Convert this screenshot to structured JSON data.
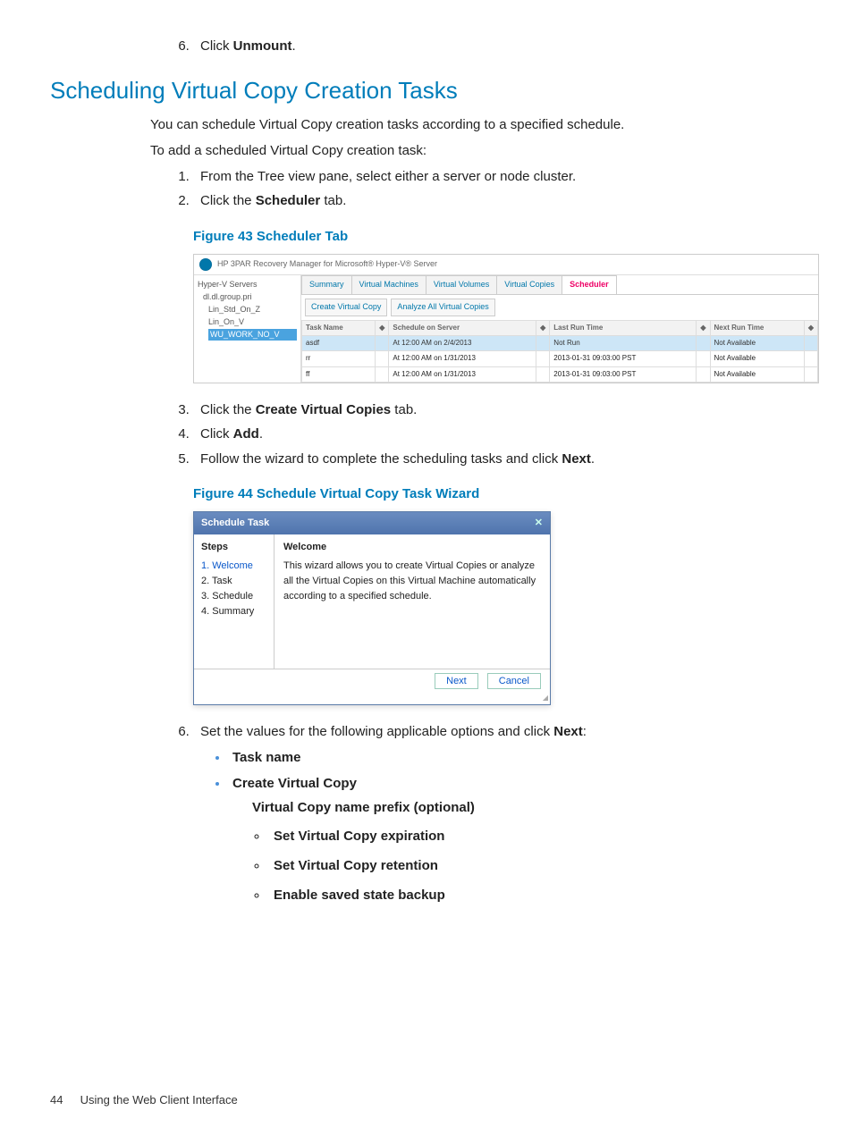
{
  "intro_list_start": 6,
  "intro_item": {
    "pre": "Click ",
    "bold": "Unmount",
    "post": "."
  },
  "section_title": "Scheduling Virtual Copy Creation Tasks",
  "para1": "You can schedule Virtual Copy creation tasks according to a specified schedule.",
  "para2": "To add a scheduled Virtual Copy creation task:",
  "steps_a": [
    {
      "text": "From the Tree view pane, select either a server or node cluster."
    },
    {
      "pre": "Click the ",
      "bold": "Scheduler",
      "post": " tab."
    }
  ],
  "fig43_caption": "Figure 43 Scheduler Tab",
  "fig43": {
    "app_title": "HP 3PAR Recovery Manager for Microsoft® Hyper-V® Server",
    "tree": {
      "root": "Hyper-V Servers",
      "group": "dl.dl.group.pri",
      "items": [
        "Lin_Std_On_Z",
        "Lin_On_V"
      ],
      "selected": "WU_WORK_NO_V"
    },
    "tabs": [
      "Summary",
      "Virtual Machines",
      "Virtual Volumes",
      "Virtual Copies",
      "Scheduler"
    ],
    "active_tab_index": 4,
    "buttons": [
      "Create Virtual Copy",
      "Analyze All Virtual Copies"
    ],
    "columns": [
      "Task Name",
      "",
      "Schedule on Server",
      "",
      "Last Run Time",
      "",
      "Next Run Time",
      ""
    ],
    "rows": [
      {
        "name": "asdf",
        "sched": "At 12:00 AM on 2/4/2013",
        "last": "Not Run",
        "next": "Not Available",
        "selected": true
      },
      {
        "name": "rr",
        "sched": "At 12:00 AM on 1/31/2013",
        "last": "2013-01-31 09:03:00 PST",
        "next": "Not Available"
      },
      {
        "name": "ff",
        "sched": "At 12:00 AM on 1/31/2013",
        "last": "2013-01-31 09:03:00 PST",
        "next": "Not Available"
      }
    ]
  },
  "steps_b": [
    {
      "pre": "Click the ",
      "bold": "Create Virtual Copies",
      "post": " tab."
    },
    {
      "pre": "Click ",
      "bold": "Add",
      "post": "."
    },
    {
      "pre": "Follow the wizard to complete the scheduling tasks and click ",
      "bold": "Next",
      "post": "."
    }
  ],
  "fig44_caption": "Figure 44 Schedule Virtual Copy Task Wizard",
  "fig44": {
    "title": "Schedule Task",
    "close_glyph": "✕",
    "steps_head": "Steps",
    "steps": [
      "1. Welcome",
      "2. Task",
      "3. Schedule",
      "4. Summary"
    ],
    "current_step_index": 0,
    "welcome_head": "Welcome",
    "welcome_body": "This wizard allows you to create Virtual Copies or analyze all the Virtual Copies on this Virtual Machine automatically according to a specified schedule.",
    "next_label": "Next",
    "cancel_label": "Cancel"
  },
  "step6": {
    "pre": "Set the values for the following applicable options and click ",
    "bold": "Next",
    "post": ":"
  },
  "opts": {
    "task_name": "Task name",
    "cvc": "Create Virtual Copy",
    "prefix": "Virtual Copy name prefix (optional)",
    "subs": [
      "Set Virtual Copy expiration",
      "Set Virtual Copy retention",
      "Enable saved state backup"
    ]
  },
  "footer": {
    "page": "44",
    "text": "Using the Web Client Interface"
  }
}
